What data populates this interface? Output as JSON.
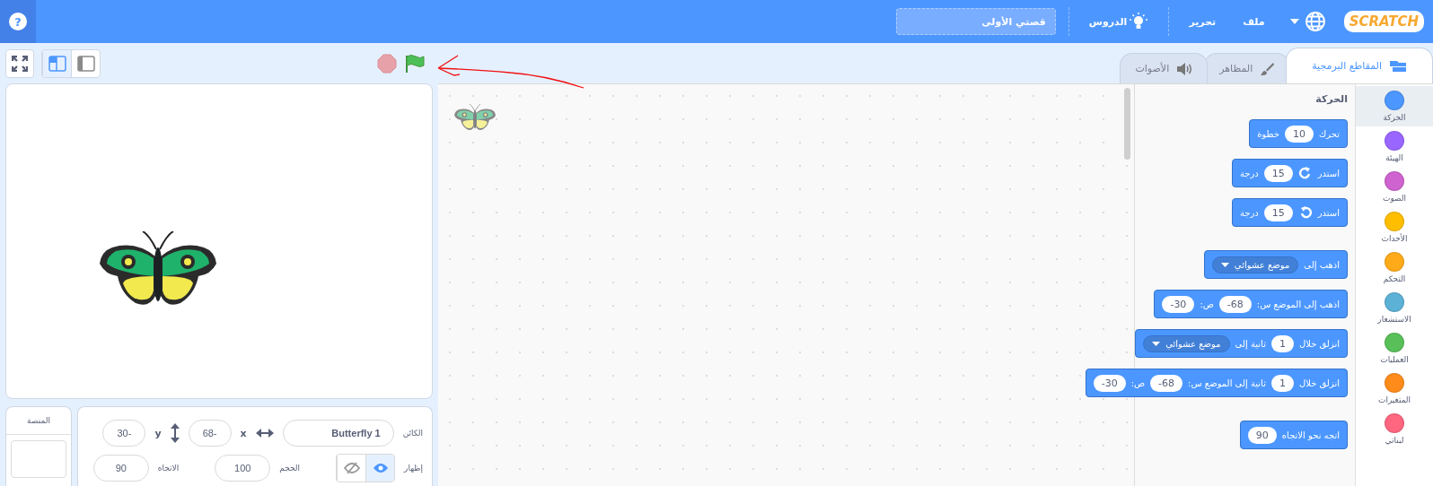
{
  "menu_bar": {
    "logo": "SCRATCH",
    "menus": [
      {
        "label": "ملف"
      },
      {
        "label": "تحرير"
      }
    ],
    "tutorials": "الدروس",
    "project_title": "قصتي الأولى",
    "help": "?"
  },
  "editor_tabs": [
    {
      "kind": "code",
      "label": "المقاطع البرمجية",
      "selected": true
    },
    {
      "kind": "costumes",
      "label": "المظاهر",
      "selected": false
    },
    {
      "kind": "sounds",
      "label": "الأصوات",
      "selected": false
    }
  ],
  "categories": [
    {
      "label": "الحركة",
      "color": "#4c97ff",
      "selected": true
    },
    {
      "label": "الهيئة",
      "color": "#9966ff",
      "selected": false
    },
    {
      "label": "الصوت",
      "color": "#cf63cf",
      "selected": false
    },
    {
      "label": "الأحداث",
      "color": "#ffbf00",
      "selected": false
    },
    {
      "label": "التحكم",
      "color": "#ffab19",
      "selected": false
    },
    {
      "label": "الاستشعار",
      "color": "#5cb1d6",
      "selected": false
    },
    {
      "label": "العمليات",
      "color": "#59c059",
      "selected": false
    },
    {
      "label": "المتغيرات",
      "color": "#ff8c1a",
      "selected": false
    },
    {
      "label": "لبناتي",
      "color": "#ff6680",
      "selected": false
    }
  ],
  "palette": {
    "heading": "الحركة",
    "block_groups": [
      [
        {
          "parts": [
            {
              "kind": "text",
              "text": "تحرك"
            },
            {
              "kind": "number",
              "text": "10"
            },
            {
              "kind": "text",
              "text": "خطوة"
            }
          ]
        },
        {
          "parts": [
            {
              "kind": "text",
              "text": "استدر"
            },
            {
              "kind": "rotate_cw"
            },
            {
              "kind": "number",
              "text": "15"
            },
            {
              "kind": "text",
              "text": "درجة"
            }
          ]
        },
        {
          "parts": [
            {
              "kind": "text",
              "text": "استدر"
            },
            {
              "kind": "rotate_ccw"
            },
            {
              "kind": "number",
              "text": "15"
            },
            {
              "kind": "text",
              "text": "درجة"
            }
          ]
        }
      ],
      [
        {
          "parts": [
            {
              "kind": "text",
              "text": "اذهب إلى"
            },
            {
              "kind": "dropdown",
              "text": "موضع عشوائي"
            }
          ]
        },
        {
          "parts": [
            {
              "kind": "text",
              "text": "اذهب إلى الموضع س:"
            },
            {
              "kind": "number",
              "text": "-68"
            },
            {
              "kind": "text",
              "text": "ص:"
            },
            {
              "kind": "number",
              "text": "-30"
            }
          ]
        },
        {
          "parts": [
            {
              "kind": "text",
              "text": "انزلق خلال"
            },
            {
              "kind": "number",
              "text": "1"
            },
            {
              "kind": "text",
              "text": "ثانية إلى"
            },
            {
              "kind": "dropdown",
              "text": "موضع عشوائي"
            }
          ]
        },
        {
          "parts": [
            {
              "kind": "text",
              "text": "انزلق خلال"
            },
            {
              "kind": "number",
              "text": "1"
            },
            {
              "kind": "text",
              "text": "ثانية إلى الموضع س:"
            },
            {
              "kind": "number",
              "text": "-68"
            },
            {
              "kind": "text",
              "text": "ص:"
            },
            {
              "kind": "number",
              "text": "-30"
            }
          ]
        }
      ],
      [
        {
          "parts": [
            {
              "kind": "text",
              "text": "اتجه نحو الاتجاه"
            },
            {
              "kind": "number",
              "text": "90"
            }
          ]
        }
      ]
    ]
  },
  "stage_size_modes": [
    {
      "kind": "large",
      "selected": false
    },
    {
      "kind": "small",
      "selected": true
    }
  ],
  "sprite_info": {
    "sprite_label": "الكائن",
    "sprite_name": "Butterfly 1",
    "x_label": "x",
    "x": "68-",
    "y_label": "y",
    "y": "30-",
    "show_label": "إظهار",
    "visible": true,
    "size_label": "الحجم",
    "size": "100",
    "direction_label": "الاتجاه",
    "direction": "90"
  },
  "stage_panel": {
    "label": "المنصة"
  }
}
